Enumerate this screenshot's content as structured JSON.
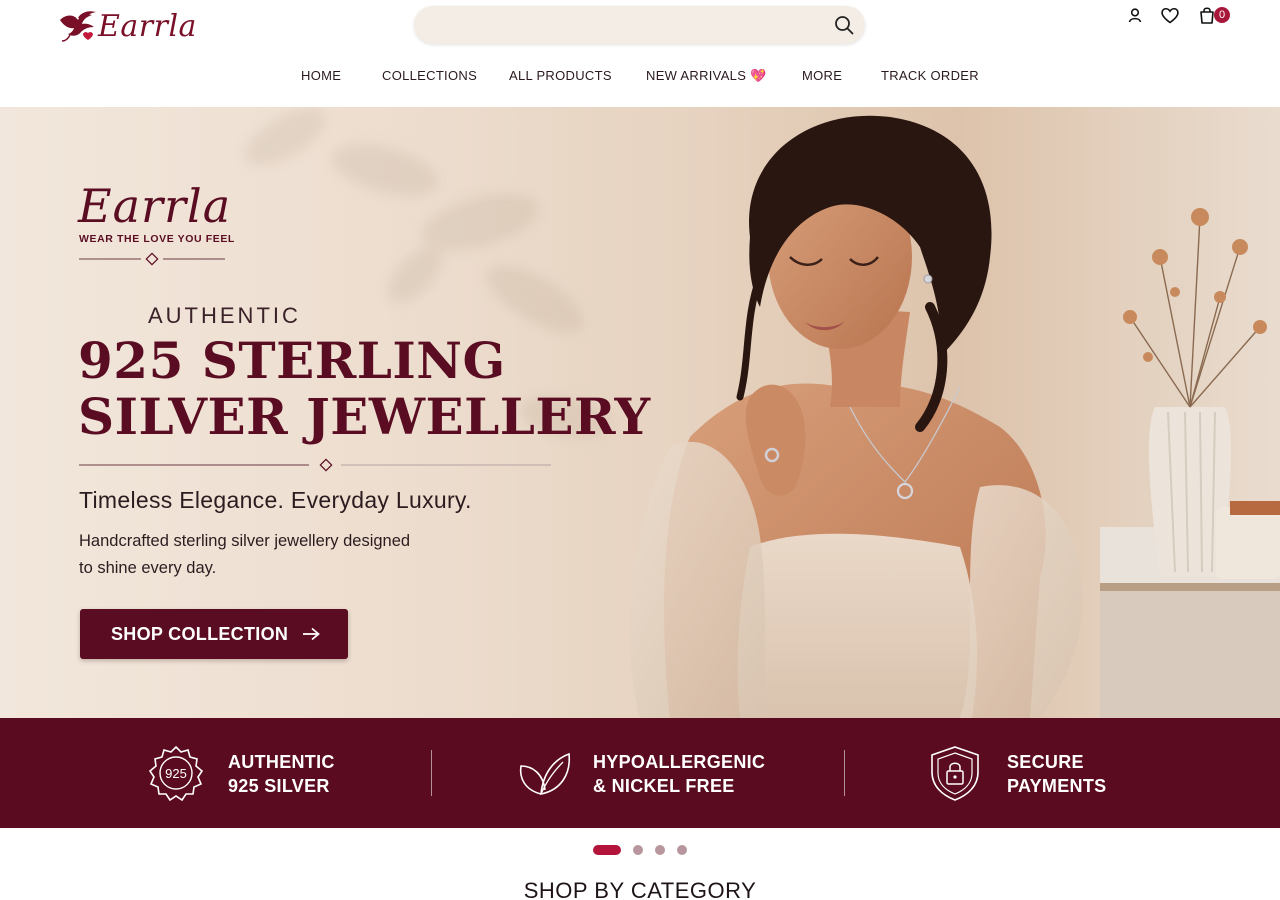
{
  "header": {
    "brand": "Earrla",
    "search": {
      "value": "",
      "placeholder": ""
    },
    "cart_count": "0",
    "icons": [
      "account-icon",
      "heart-icon",
      "bag-icon",
      "search-icon"
    ]
  },
  "nav": {
    "items": [
      "HOME",
      "COLLECTIONS",
      "ALL PRODUCTS",
      "NEW ARRIVALS 💖",
      "MORE",
      "TRACK ORDER"
    ]
  },
  "hero": {
    "brand": "Earrla",
    "tagline": "WEAR THE LOVE YOU FEEL",
    "eyebrow": "AUTHENTIC",
    "headline_line1": "925 STERLING",
    "headline_line2": "SILVER JEWELLERY",
    "subhead": "Timeless Elegance. Everyday Luxury.",
    "description_line1": "Handcrafted sterling silver jewellery designed",
    "description_line2": "to shine every day.",
    "cta": "SHOP COLLECTION"
  },
  "features": [
    {
      "icon": "925-seal-icon",
      "badge": "925",
      "text": "AUTHENTIC\n925 SILVER"
    },
    {
      "icon": "leaf-icon",
      "text": "HYPOALLERGENIC\n& NICKEL FREE"
    },
    {
      "icon": "shield-lock-icon",
      "text": "SECURE\nPAYMENTS"
    }
  ],
  "carousel": {
    "slides": 4,
    "active": 1
  },
  "sections": {
    "category_title": "SHOP BY CATEGORY"
  },
  "colors": {
    "brand_maroon": "#5a0d22",
    "band_maroon": "#5a0b1f",
    "accent_red": "#a8173a",
    "search_bg": "#f3ede6"
  }
}
